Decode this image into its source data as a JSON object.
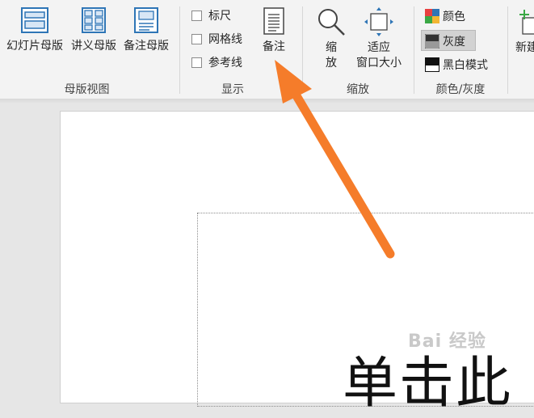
{
  "ribbon": {
    "master_views": {
      "group_label": "母版视图",
      "buttons": [
        {
          "label": "幻灯片母版"
        },
        {
          "label": "讲义母版"
        },
        {
          "label": "备注母版"
        }
      ]
    },
    "show": {
      "group_label": "显示",
      "checkboxes": [
        {
          "label": "标尺",
          "checked": false
        },
        {
          "label": "网格线",
          "checked": false
        },
        {
          "label": "参考线",
          "checked": false
        }
      ],
      "notes_button": "备注"
    },
    "zoom": {
      "group_label": "缩放",
      "zoom_label_line1": "缩",
      "zoom_label_line2": "放",
      "fit_label_line1": "适应",
      "fit_label_line2": "窗口大小"
    },
    "color": {
      "group_label": "颜色/灰度",
      "options": [
        {
          "label": "颜色",
          "selected": false
        },
        {
          "label": "灰度",
          "selected": true
        },
        {
          "label": "黑白模式",
          "selected": false
        }
      ]
    },
    "new_partial": "新建"
  },
  "slide": {
    "text": "单击此",
    "watermark": "Bai 经验"
  },
  "colors": {
    "ribbon_bg": "#f3f3f3",
    "workspace_bg": "#e6e6e6",
    "accent_blue": "#2e75b6",
    "arrow": "#f57c2a"
  }
}
